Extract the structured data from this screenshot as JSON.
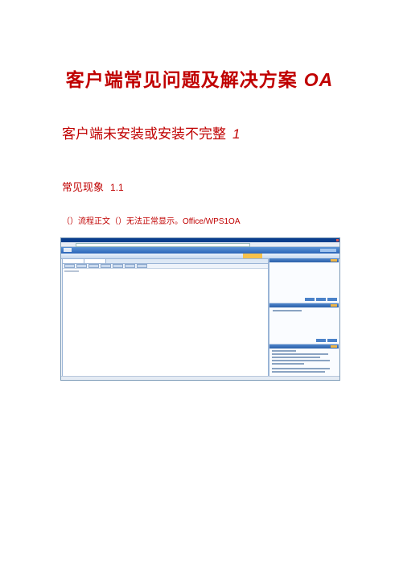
{
  "doc": {
    "title_main": "客户端常见问题及解决方案",
    "title_suffix": "OA",
    "section_title": "客户端未安装或安装不完整",
    "section_number": "1",
    "subsection_title": "常见现象",
    "subsection_number": "1.1",
    "body_text_cn": "（）流程正文（）无法正常显示。",
    "body_text_en": "Office/WPS1OA"
  },
  "screenshot": {
    "menu_items": [
      "",
      "",
      "",
      "",
      "",
      "",
      "",
      "",
      "",
      "",
      "",
      ""
    ],
    "active_menu_index": 9,
    "colors": {
      "banner": "#2c66b8",
      "active_tab": "#f7c14a",
      "heading_red": "#c00000"
    }
  }
}
